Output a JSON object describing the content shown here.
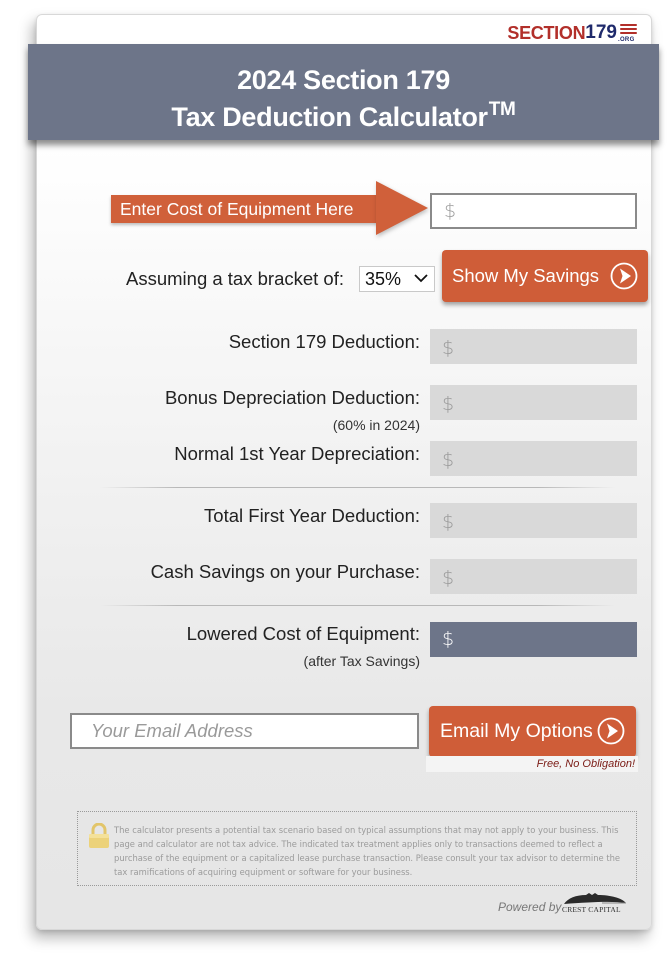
{
  "brand": {
    "logo_word": "SECTION",
    "logo_number": "179",
    "logo_suffix": ".ORG",
    "colors": {
      "red": "#b22f2a",
      "navy": "#1f2a6b"
    }
  },
  "header": {
    "title_line1": "2024 Section 179",
    "title_line2": "Tax Deduction Calculator",
    "trademark": "TM",
    "background": "#6d7589"
  },
  "cost_entry": {
    "callout_label": "Enter Cost of Equipment Here",
    "input_placeholder": "$",
    "input_value": ""
  },
  "tax_bracket": {
    "label": "Assuming a tax bracket of:",
    "selected": "35%"
  },
  "buttons": {
    "show_savings": "Show My Savings",
    "email_options": "Email My Options",
    "accent": "#cf5d38"
  },
  "results": [
    {
      "label": "Section 179 Deduction:",
      "sublabel": "",
      "value": "$"
    },
    {
      "label": "Bonus Depreciation Deduction:",
      "sublabel": "(60% in 2024)",
      "value": "$"
    },
    {
      "label": "Normal 1st Year Depreciation:",
      "sublabel": "",
      "value": "$"
    },
    {
      "label": "Total First Year Deduction:",
      "sublabel": "",
      "value": "$"
    },
    {
      "label": "Cash Savings on your Purchase:",
      "sublabel": "",
      "value": "$"
    },
    {
      "label": "Lowered Cost of Equipment:",
      "sublabel": "(after Tax Savings)",
      "value": "$"
    }
  ],
  "email": {
    "placeholder": "Your Email Address",
    "value": "",
    "note": "Free, No Obligation!"
  },
  "disclaimer": {
    "icon": "lock-icon",
    "text": "The calculator presents a potential tax scenario based on typical assumptions that may not apply to your business. This page and calculator are not tax advice. The indicated tax treatment applies only to transactions deemed to reflect a purchase of the equipment or a capitalized lease purchase transaction. Please consult your tax advisor to determine the tax ramifications of acquiring equipment or software for your business."
  },
  "footer": {
    "powered_by": "Powered by",
    "partner": "CREST CAPITAL"
  }
}
